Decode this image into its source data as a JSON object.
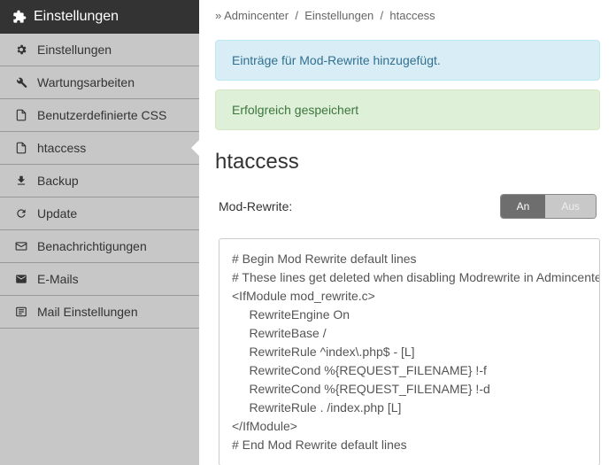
{
  "sidebar": {
    "title": "Einstellungen",
    "items": [
      {
        "label": "Einstellungen"
      },
      {
        "label": "Wartungsarbeiten"
      },
      {
        "label": "Benutzerdefinierte CSS"
      },
      {
        "label": "htaccess"
      },
      {
        "label": "Backup"
      },
      {
        "label": "Update"
      },
      {
        "label": "Benachrichtigungen"
      },
      {
        "label": "E-Mails"
      },
      {
        "label": "Mail Einstellungen"
      }
    ]
  },
  "breadcrumb": {
    "arrow": "»",
    "p1": "Admincenter",
    "sep": "/",
    "p2": "Einstellungen",
    "p3": "htaccess"
  },
  "alerts": {
    "info": "Einträge für Mod-Rewrite hinzugefügt.",
    "success": "Erfolgreich gespeichert"
  },
  "page": {
    "title": "htaccess"
  },
  "form": {
    "modrewrite_label": "Mod-Rewrite:",
    "toggle_on": "An",
    "toggle_off": "Aus",
    "code": "# Begin Mod Rewrite default lines\n# These lines get deleted when disabling Modrewrite in Admincenter!\n<IfModule mod_rewrite.c>\n     RewriteEngine On\n     RewriteBase /\n     RewriteRule ^index\\.php$ - [L]\n     RewriteCond %{REQUEST_FILENAME} !-f\n     RewriteCond %{REQUEST_FILENAME} !-d\n     RewriteRule . /index.php [L]\n</IfModule>\n# End Mod Rewrite default lines"
  }
}
